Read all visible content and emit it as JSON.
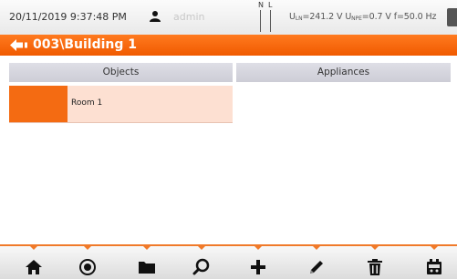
{
  "status_bar": {
    "datetime": "20/11/2019 9:37:48 PM",
    "user": "admin",
    "user_icon": "user-icon",
    "phase_labels": {
      "n": "N",
      "l": "L"
    },
    "measurement": {
      "uln_label": "U",
      "uln_sub": "LN",
      "uln_value": "=241.2 V",
      "unpe_label": "U",
      "unpe_sub": "NPE",
      "unpe_value": "=0.7 V",
      "freq": "f=50.0 Hz"
    },
    "battery_icon": "battery-icon"
  },
  "titlebar": {
    "back_icon": "back-arrow-icon",
    "title": "003\\Building 1"
  },
  "tabs": [
    {
      "label": "Objects",
      "active": true
    },
    {
      "label": "Appliances",
      "active": false
    }
  ],
  "objects": [
    {
      "label": "Room 1",
      "swatch_color": "#f46b12"
    }
  ],
  "toolbar": {
    "accent": "#f07a2a",
    "buttons": [
      {
        "icon": "home-icon"
      },
      {
        "icon": "record-icon"
      },
      {
        "icon": "folder-icon"
      },
      {
        "icon": "search-icon"
      },
      {
        "icon": "add-icon"
      },
      {
        "icon": "edit-icon"
      },
      {
        "icon": "delete-icon"
      },
      {
        "icon": "meter-icon"
      }
    ]
  },
  "colors": {
    "accent": "#f46b12",
    "selection": "#fde0d2"
  }
}
